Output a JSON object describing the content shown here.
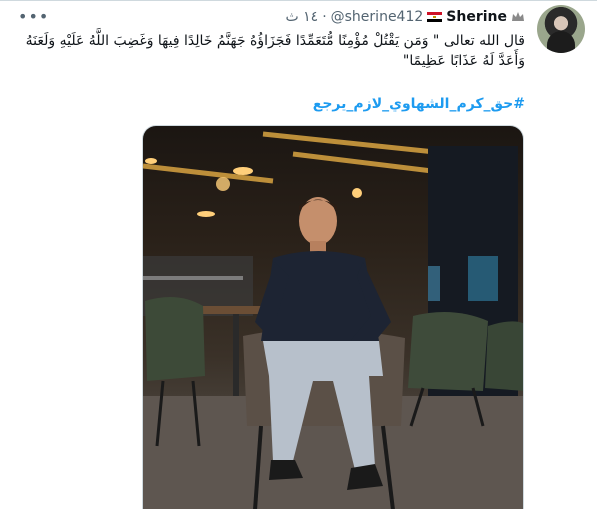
{
  "tweet": {
    "author_name": "Sherine",
    "badge_icon": "crown-icon",
    "flag": "egypt-flag-icon",
    "handle": "@sherine412",
    "separator": "·",
    "time": "١٤ ث",
    "more_icon": "more-horizontal-icon",
    "text": "قال الله تعالى \" وَمَن يَقْتُلْ مُؤْمِنًا مُّتَعَمِّدًا فَجَزَاؤُهُ جَهَنَّمُ خَالِدًا فِيهَا وَغَضِبَ اللَّهُ عَلَيْهِ وَلَعَنَهُ وَأَعَدَّ لَهُ عَذَابًا عَظِيمًا\"",
    "hashtag": "#حق_كرم_الشهاوي_لازم_يرجع",
    "media_description": "photo",
    "colors": {
      "link": "#1d9bf0",
      "muted": "#536471",
      "text": "#0f1419"
    }
  }
}
